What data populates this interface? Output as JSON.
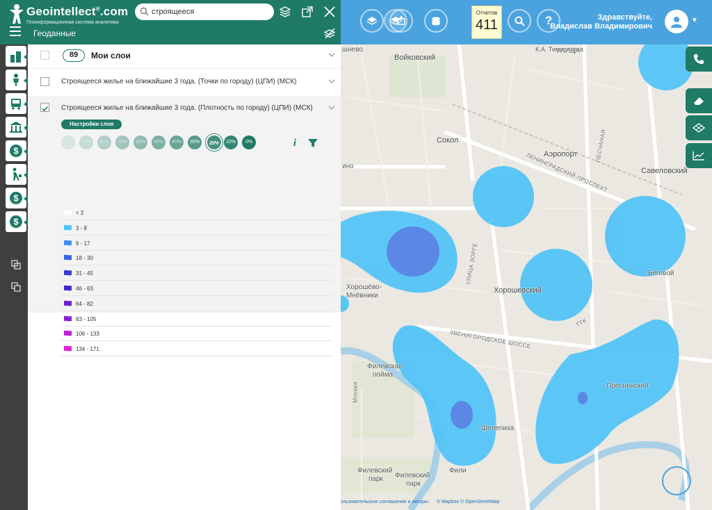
{
  "header": {
    "logo_name": "Geointellect",
    "logo_suffix": ".com",
    "logo_subtitle": "Геоинформационная система аналитика",
    "search_value": "строящееся",
    "panel_title": "Геоданные",
    "brand_color": "#1f7a66"
  },
  "topbar": {
    "reports_label": "Отчетов",
    "reports_count": "411",
    "greeting_line1": "Здравствуйте,",
    "greeting_line2": "Владислав Владимирович",
    "bar_color": "#4aa3df"
  },
  "layers": {
    "my_layers_count": "89",
    "my_layers_title": "Мои слои",
    "layer1_name": "Строящееся жилье на ближайшие 3 года. (Точки по городу) (ЦПИ) (МСК)",
    "layer1_checked": false,
    "layer2_name": "Строящееся жилье на ближайшие 3 года. (Плотность по городу) (ЦПИ) (МСК)",
    "layer2_checked": true,
    "settings_label": "Настройки слоя",
    "opacity_levels": [
      "100%",
      "90%",
      "80%",
      "70%",
      "60%",
      "50%",
      "40%",
      "30%",
      "20%",
      "10%",
      "0%"
    ],
    "opacity_selected": "20%",
    "legend": [
      {
        "label": "< 2",
        "color": "#ffffff"
      },
      {
        "label": "3 - 8",
        "color": "#4fc3f7"
      },
      {
        "label": "9 - 17",
        "color": "#3f8ff0"
      },
      {
        "label": "18 - 30",
        "color": "#3b62e8"
      },
      {
        "label": "31 - 45",
        "color": "#3a3ad9"
      },
      {
        "label": "46 - 63",
        "color": "#4a23d0"
      },
      {
        "label": "64 - 82",
        "color": "#6a1fd0"
      },
      {
        "label": "83 - 105",
        "color": "#8e1fd6"
      },
      {
        "label": "106 - 133",
        "color": "#c21fd8"
      },
      {
        "label": "134 - 171",
        "color": "#e21fd0"
      }
    ]
  },
  "map": {
    "labels": {
      "voykovsky": "Войковский",
      "timiryazeva": "К.А. Тимирязева",
      "ulitsa": "УЛИЦА",
      "sokol": "Сокол",
      "aeroport": "Аэропорт",
      "savelovsky": "Савеловский",
      "leningradsky": "ЛЕНИНГРАДСКИЙ ПРОСПЕКТ",
      "khoroshevo": "Хорошёво-",
      "mnevniki": "Мнёвники",
      "khoroshevsky": "Хорошевский",
      "begovoy": "Беговой",
      "zvenigorodskoe": "ЗВЕНИГОРОДСКОЕ ШОССЕ",
      "filevskaya": "Филевская",
      "poima": "пойма",
      "presnensky": "Пресненский",
      "shelepikha": "Шелепиха",
      "filevsky_park1": "Филевский",
      "filevsky_park2": "парк",
      "filevsky2_1": "Филевский",
      "filevsky2_2": "парк",
      "fili": "Фили",
      "ino": "ино",
      "nevo": "шнево",
      "ulitsa_zorge": "УЛИЦА ЗОРГЕ",
      "peschanaya": "ПЕСЧАНАЯ",
      "ttk": "ТТК",
      "moskva": "Москва"
    },
    "attribution_terms": "Пользовательское соглашение и авторы",
    "attribution_mapbox": "© Mapbox © OpenStreetMap",
    "heat_color": "#4fc3f7",
    "heat_core_color": "#5b8ee6"
  }
}
